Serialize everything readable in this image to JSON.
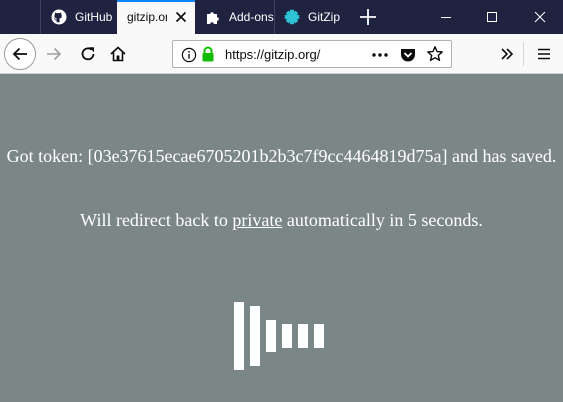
{
  "tabs": [
    {
      "label": "GitHub",
      "icon": "github-icon",
      "active": false
    },
    {
      "label": "gitzip.org",
      "icon": "none",
      "active": true
    },
    {
      "label": "Add-ons",
      "icon": "puzzle-icon",
      "active": false
    },
    {
      "label": "GitZip",
      "icon": "gitzip-icon",
      "active": false
    }
  ],
  "urlbar": {
    "url": "https://gitzip.org/"
  },
  "page": {
    "token_message": "Got token: [03e37615ecae6705201b2b3c7f9cc4464819d75a] and has saved.",
    "redirect_prefix": "Will redirect back to ",
    "redirect_link": "private",
    "redirect_suffix": " automatically in 5 seconds."
  },
  "colors": {
    "page_background": "#7b8786",
    "tab_strip": "#202340",
    "accent": "#0a84ff",
    "lock_green": "#12bc00",
    "text": "#ffffff"
  }
}
